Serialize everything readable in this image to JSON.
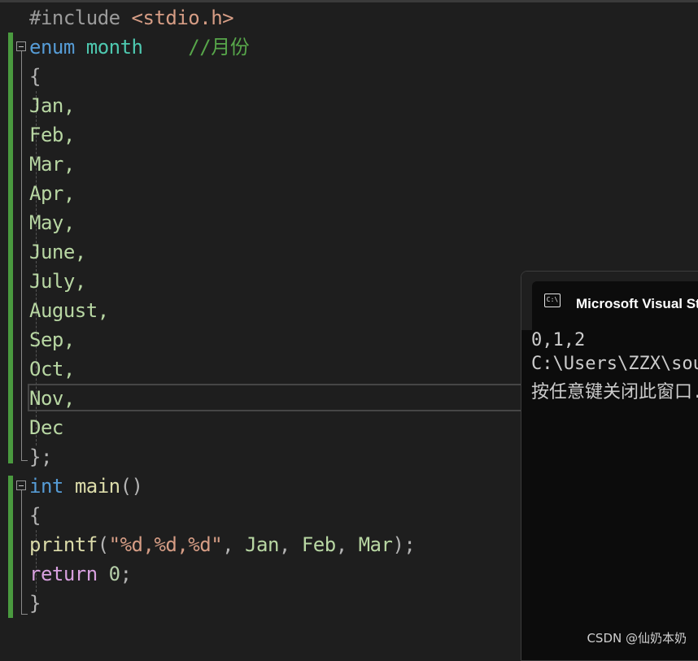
{
  "editor": {
    "include": {
      "directive": "#include",
      "header": "<stdio.h>"
    },
    "enum_decl": {
      "keyword": "enum",
      "name": "month",
      "comment": "//月份"
    },
    "open_brace": "{",
    "enumerators": [
      "Jan,",
      "Feb,",
      "Mar,",
      "Apr,",
      "May,",
      "June,",
      "July,",
      "August,",
      "Sep,",
      "Oct,",
      "Nov,",
      "Dec"
    ],
    "close_enum": "};",
    "main_decl": {
      "type": "int",
      "name": "main",
      "parens": "()"
    },
    "main_open": "{",
    "printf_line": {
      "fn": "printf",
      "lparen": "(",
      "q1": "\"",
      "fmt": "%d,%d,%d",
      "q2": "\"",
      "sep1": ", ",
      "arg1": "Jan",
      "sep2": ", ",
      "arg2": "Feb",
      "sep3": ", ",
      "arg3": "Mar",
      "end": ");"
    },
    "return_line": {
      "keyword": "return",
      "value": "0",
      "end": ";"
    },
    "main_close": "}"
  },
  "console": {
    "title": "Microsoft Visual Studio 调试控制台",
    "icon": "cmd-icon",
    "lines": [
      "0,1,2",
      "C:\\Users\\ZZX\\source",
      "按任意键关闭此窗口..."
    ]
  },
  "watermark": "CSDN @仙奶本奶",
  "colors": {
    "background": "#1e1e1e",
    "keyword": "#569cd6",
    "type": "#4ec9b0",
    "comment": "#57a64a",
    "enum_member": "#b8d7a3",
    "string": "#d69d85",
    "function": "#dcdcaa",
    "control": "#d8a0df",
    "gutter_green": "#4a9a3f"
  }
}
